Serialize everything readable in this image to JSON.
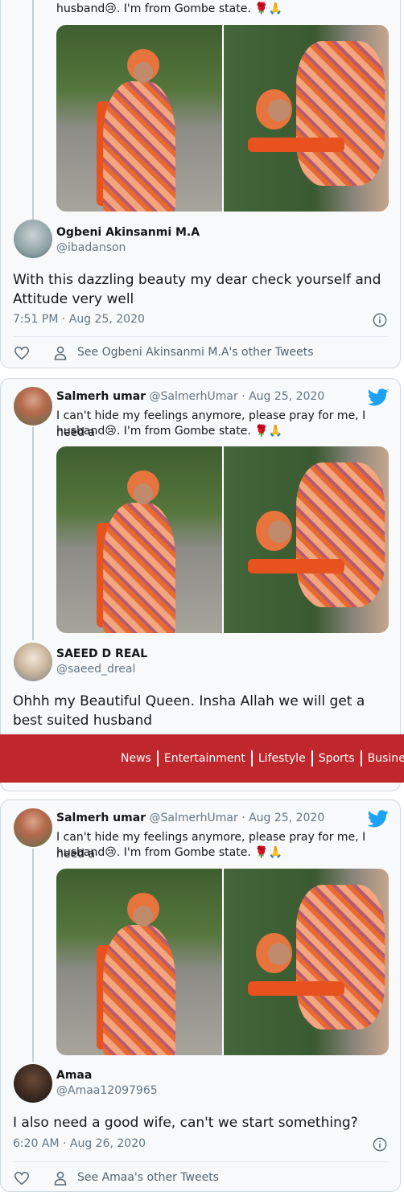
{
  "original_tweet": {
    "name": "Salmerh umar",
    "handle_date": "@SalmerhUmar · Aug 25, 2020",
    "text_line1": "I can't hide my feelings anymore, please pray for me, I need a",
    "text_line2": "husband😢. I'm from Gombe state. 🌹🙏"
  },
  "cards": [
    {
      "reply": {
        "name": "Ogbeni Akinsanmi M.A",
        "handle": "@ibadanson",
        "text": "With this dazzling beauty my dear check yourself and Attitude very well",
        "timestamp": "7:51 PM · Aug 25, 2020",
        "see_other": "See Ogbeni Akinsanmi M.A's other Tweets"
      }
    },
    {
      "reply": {
        "name": "SAEED D REAL",
        "handle": "@saeed_dreal",
        "text": "Ohhh my Beautiful Queen. Insha Allah we will get a best suited husband"
      }
    },
    {
      "reply": {
        "name": "Amaa",
        "handle": "@Amaa12097965",
        "text": "I also need a good wife, can't we start something?",
        "timestamp": "6:20 AM · Aug 26, 2020",
        "see_other": "See Amaa's other Tweets"
      }
    }
  ],
  "navbar": {
    "items": [
      "News",
      "Entertainment",
      "Lifestyle",
      "Sports",
      "Business"
    ]
  },
  "colors": {
    "twitter_blue": "#1da1f2",
    "navbar_red": "#c0272d",
    "card_bg": "#f7f9fa"
  }
}
